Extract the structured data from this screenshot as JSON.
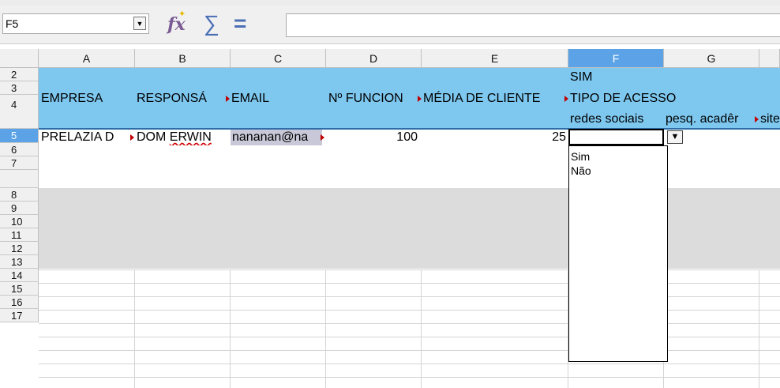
{
  "name_box": {
    "value": "F5"
  },
  "toolbar": {
    "function_wizard_icon": "fx-icon",
    "sum_icon": "sum-icon",
    "formula_icon": "equals-icon",
    "formula_value": ""
  },
  "columns": [
    "A",
    "B",
    "C",
    "D",
    "E",
    "F",
    "G"
  ],
  "selected_column": "F",
  "rows": [
    "2",
    "3",
    "4",
    "5",
    "6",
    "7",
    "8",
    "9",
    "10",
    "11",
    "12",
    "13",
    "14",
    "15",
    "16",
    "17"
  ],
  "selected_row": "5",
  "cells": {
    "f2": "SIM",
    "a3": "EMPRESA",
    "b3": "RESPONSÁ",
    "c3": "EMAIL",
    "d3": "Nº FUNCION",
    "e3": "MÉDIA DE CLIENTE",
    "f3": "TIPO DE ACESSO",
    "f4": "redes sociais",
    "g4": "pesq. acadêr",
    "h4": "site",
    "a5": "PRELAZIA D",
    "b5_part1": "DOM ",
    "b5_part2": "ERWIN",
    "c5": "nananan@na",
    "d5": "100",
    "e5": "25"
  },
  "dropdown": {
    "options": [
      "Sim",
      "Não"
    ]
  },
  "colors": {
    "header_band": "#7ec8f0",
    "grey_band": "#dcdcdc",
    "selection": "#5ba3e6"
  }
}
